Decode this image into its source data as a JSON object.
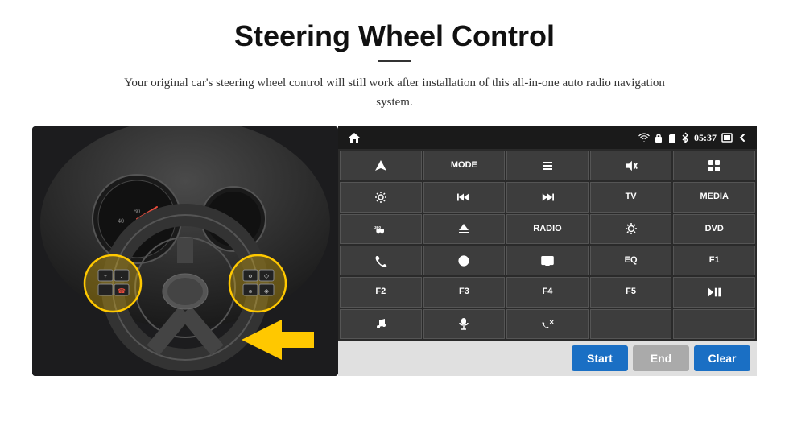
{
  "header": {
    "title": "Steering Wheel Control",
    "divider": true,
    "subtitle": "Your original car's steering wheel control will still work after installation of this all-in-one auto radio navigation system."
  },
  "statusBar": {
    "time": "05:37",
    "icons": [
      "wifi",
      "lock",
      "sim",
      "bluetooth",
      "fullscreen",
      "back"
    ]
  },
  "buttons": [
    {
      "id": "r1c1",
      "type": "icon",
      "iconType": "navigate"
    },
    {
      "id": "r1c2",
      "type": "text",
      "label": "MODE"
    },
    {
      "id": "r1c3",
      "type": "icon",
      "iconType": "list"
    },
    {
      "id": "r1c4",
      "type": "icon",
      "iconType": "mute"
    },
    {
      "id": "r1c5",
      "type": "icon",
      "iconType": "grid"
    },
    {
      "id": "r2c1",
      "type": "icon",
      "iconType": "settings"
    },
    {
      "id": "r2c2",
      "type": "icon",
      "iconType": "rewind"
    },
    {
      "id": "r2c3",
      "type": "icon",
      "iconType": "forward"
    },
    {
      "id": "r2c4",
      "type": "text",
      "label": "TV"
    },
    {
      "id": "r2c5",
      "type": "text",
      "label": "MEDIA"
    },
    {
      "id": "r3c1",
      "type": "icon",
      "iconType": "360car"
    },
    {
      "id": "r3c2",
      "type": "icon",
      "iconType": "eject"
    },
    {
      "id": "r3c3",
      "type": "text",
      "label": "RADIO"
    },
    {
      "id": "r3c4",
      "type": "icon",
      "iconType": "brightness"
    },
    {
      "id": "r3c5",
      "type": "text",
      "label": "DVD"
    },
    {
      "id": "r4c1",
      "type": "icon",
      "iconType": "phone"
    },
    {
      "id": "r4c2",
      "type": "icon",
      "iconType": "globe"
    },
    {
      "id": "r4c3",
      "type": "icon",
      "iconType": "display"
    },
    {
      "id": "r4c4",
      "type": "text",
      "label": "EQ"
    },
    {
      "id": "r4c5",
      "type": "text",
      "label": "F1"
    },
    {
      "id": "r5c1",
      "type": "text",
      "label": "F2"
    },
    {
      "id": "r5c2",
      "type": "text",
      "label": "F3"
    },
    {
      "id": "r5c3",
      "type": "text",
      "label": "F4"
    },
    {
      "id": "r5c4",
      "type": "text",
      "label": "F5"
    },
    {
      "id": "r5c5",
      "type": "icon",
      "iconType": "playpause"
    },
    {
      "id": "r6c1",
      "type": "icon",
      "iconType": "music"
    },
    {
      "id": "r6c2",
      "type": "icon",
      "iconType": "mic"
    },
    {
      "id": "r6c3",
      "type": "icon",
      "iconType": "phoneanswer"
    }
  ],
  "bottomBar": {
    "startLabel": "Start",
    "endLabel": "End",
    "clearLabel": "Clear"
  }
}
